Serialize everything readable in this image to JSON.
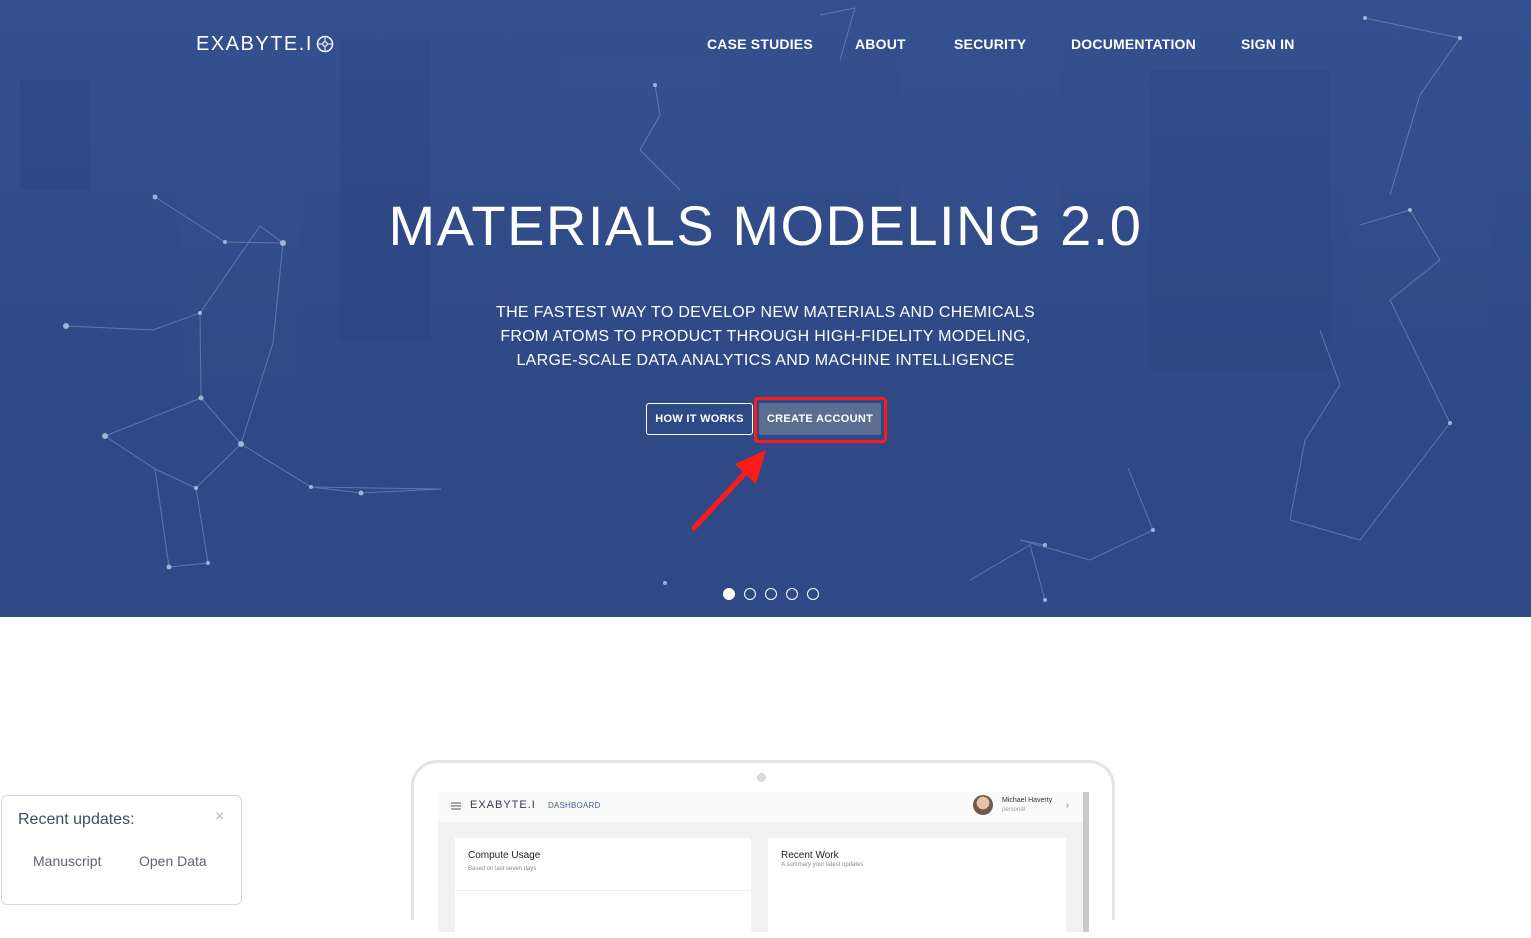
{
  "header": {
    "logo": "EXABYTE.I",
    "nav": [
      {
        "label": "CASE STUDIES"
      },
      {
        "label": "ABOUT"
      },
      {
        "label": "SECURITY"
      },
      {
        "label": "DOCUMENTATION"
      },
      {
        "label": "SIGN IN"
      }
    ]
  },
  "hero": {
    "title": "MATERIALS MODELING 2.0",
    "subtitle_lines": [
      "THE FASTEST WAY TO DEVELOP NEW MATERIALS AND CHEMICALS",
      "FROM ATOMS TO PRODUCT THROUGH HIGH-FIDELITY MODELING,",
      "LARGE-SCALE DATA ANALYTICS AND MACHINE INTELLIGENCE"
    ],
    "buttons": {
      "how": "HOW IT WORKS",
      "create": "CREATE ACCOUNT"
    },
    "carousel": {
      "total": 5,
      "active": 1
    }
  },
  "preview": {
    "logo": "EXABYTE.I",
    "section": "DASHBOARD",
    "user": {
      "name": "Michael Haverty",
      "plan": "personal"
    },
    "cards": [
      {
        "title": "Compute Usage",
        "subtitle": "Based on last seven days"
      },
      {
        "title": "Recent Work",
        "subtitle": "A summary your latest updates"
      }
    ]
  },
  "updates_panel": {
    "title": "Recent updates:",
    "close": "×",
    "links": [
      "Manuscript",
      "Open Data"
    ]
  },
  "colors": {
    "hero_bg": "#2f4a86",
    "highlight": "#ff1a1a",
    "create_button": "#5b6e92"
  }
}
